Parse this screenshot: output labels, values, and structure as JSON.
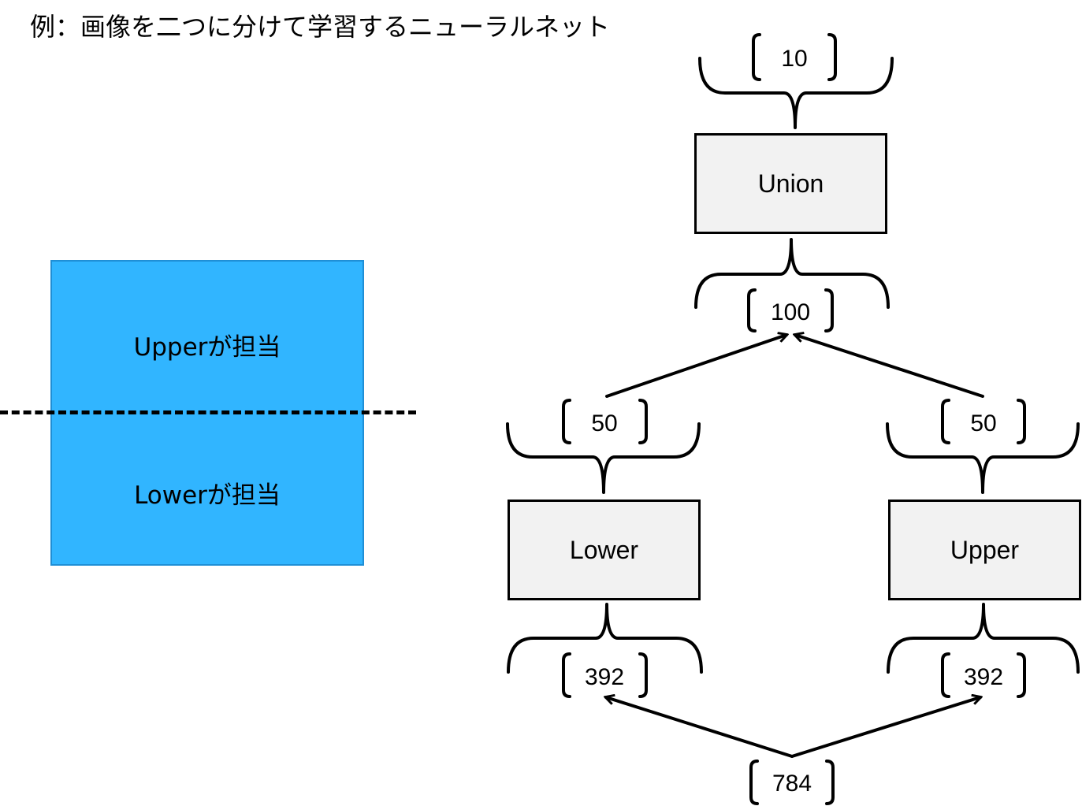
{
  "title": "例：画像を二つに分けて学習するニューラルネット",
  "image": {
    "upper_label": "Upperが担当",
    "lower_label": "Lowerが担当",
    "fill_color": "#31b5ff"
  },
  "network": {
    "union_label": "Union",
    "lower_label": "Lower",
    "upper_label": "Upper",
    "output_size": "10",
    "union_input_size": "100",
    "lower_output_size": "50",
    "upper_output_size": "50",
    "lower_input_size": "392",
    "upper_input_size": "392",
    "image_input_size": "784"
  }
}
